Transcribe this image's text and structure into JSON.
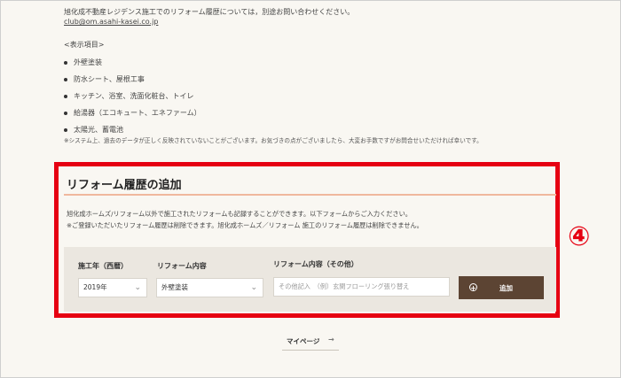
{
  "intro": {
    "line": "旭化成不動産レジデンス施工でのリフォーム履歴については，別途お問い合わせください。",
    "email": "club@om.asahi-kasei.co.jp"
  },
  "display_items": {
    "heading": "<表示項目>",
    "items": [
      "外壁塗装",
      "防水シート、屋根工事",
      "キッチン、浴室、洗面化粧台、トイレ",
      "給湯器（エコキュート、エネファーム）",
      "太陽光、蓄電池"
    ],
    "note": "※システム上、過去のデータが正しく反映されていないことがございます。お気づきの点がございましたら、大変お手数ですがお問合せいただければ幸いです。"
  },
  "section": {
    "title": "リフォーム履歴の追加",
    "desc1": "旭化成ホームズ/リフォーム以外で施工されたリフォームも記録することができます。以下フォームからご入力ください。",
    "desc2": "※ご登録いただいたリフォーム履歴は削除できます。旭化成ホームズ／リフォーム 施工のリフォーム履歴は削除できません。"
  },
  "form": {
    "year_label": "施工年（西暦）",
    "year_value": "2019年",
    "content_label": "リフォーム内容",
    "content_value": "外壁塗装",
    "other_label": "リフォーム内容（その他）",
    "other_placeholder": "その他記入　（例）玄関フローリング張り替え",
    "add_label": "追加"
  },
  "annotation": "④",
  "mypage": {
    "label": "マイページ",
    "arrow": "→"
  },
  "colors": {
    "highlight": "#e60012",
    "button": "#5c4433",
    "rule": "#f0b89d",
    "background": "#f9f7f2"
  }
}
